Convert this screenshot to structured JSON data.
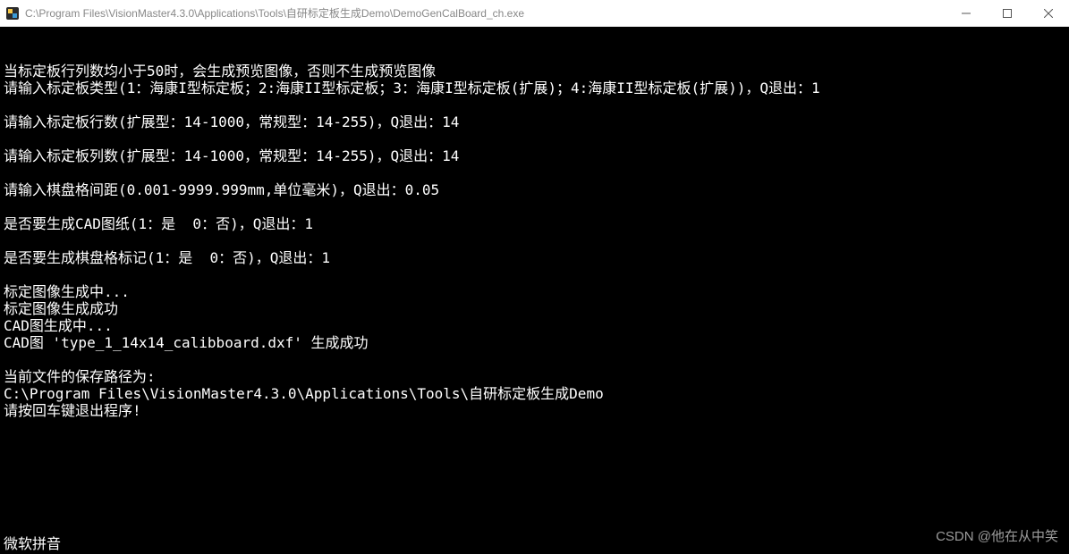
{
  "window": {
    "title": "C:\\Program Files\\VisionMaster4.3.0\\Applications\\Tools\\自研标定板生成Demo\\DemoGenCalBoard_ch.exe"
  },
  "lines": [
    "当标定板行列数均小于50时，会生成预览图像，否则不生成预览图像",
    "请输入标定板类型(1：海康I型标定板；2:海康II型标定板；3：海康I型标定板(扩展)；4:海康II型标定板(扩展))，Q退出：1",
    "",
    "请输入标定板行数(扩展型：14-1000，常规型：14-255)，Q退出：14",
    "",
    "请输入标定板列数(扩展型：14-1000，常规型：14-255)，Q退出：14",
    "",
    "请输入棋盘格间距(0.001-9999.999mm,单位毫米)，Q退出：0.05",
    "",
    "是否要生成CAD图纸(1：是  0：否)，Q退出：1",
    "",
    "是否要生成棋盘格标记(1：是  0：否)，Q退出：1",
    "",
    "标定图像生成中...",
    "标定图像生成成功",
    "CAD图生成中...",
    "CAD图 'type_1_14x14_calibboard.dxf' 生成成功",
    "",
    "当前文件的保存路径为:",
    "C:\\Program Files\\VisionMaster4.3.0\\Applications\\Tools\\自研标定板生成Demo",
    "请按回车键退出程序!"
  ],
  "bottom_partial": "微软拼音",
  "watermark": "CSDN @他在从中笑"
}
